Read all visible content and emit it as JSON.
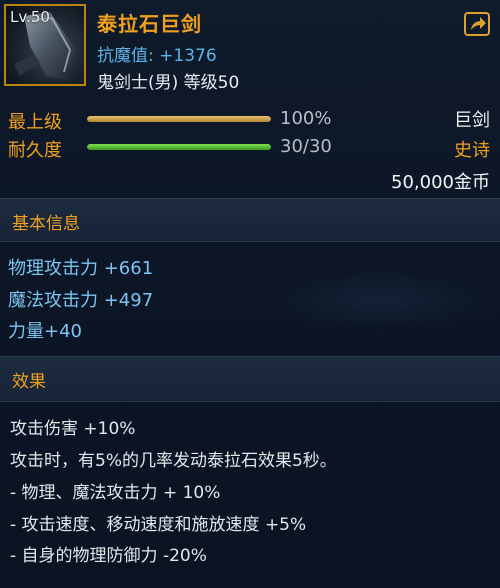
{
  "header": {
    "level": "Lv.50",
    "name": "泰拉石巨剑",
    "resistance": "抗魔值: +1376",
    "requirement": "鬼剑士(男) 等级50",
    "type": "巨剑",
    "rarity": "史诗",
    "price": "50,000金币",
    "icon": "sword-icon",
    "share_icon": "share-arrow-icon"
  },
  "bars": {
    "grade": {
      "label": "最上级",
      "value": "100%",
      "fill": 1.0,
      "color": "#c9a24a"
    },
    "durability": {
      "label": "耐久度",
      "value": "30/30",
      "fill": 1.0,
      "color": "#5cc234"
    }
  },
  "basic_info": {
    "title": "基本信息",
    "stats": [
      "物理攻击力 +661",
      "魔法攻击力 +497",
      "力量+40"
    ]
  },
  "effects": {
    "title": "效果",
    "lines": [
      "攻击伤害 +10%",
      "攻击时，有5%的几率发动泰拉石效果5秒。",
      " - 物理、魔法攻击力 + 10%",
      " - 攻击速度、移动速度和施放速度 +5%",
      " - 自身的物理防御力 -20%"
    ]
  },
  "colors": {
    "accent": "#f0a020",
    "stat_blue": "#7cc4f0",
    "background": "#0c1626"
  }
}
